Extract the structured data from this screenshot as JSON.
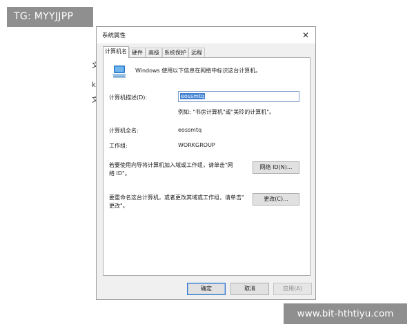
{
  "watermarks": {
    "top": "TG: MYYJJPP",
    "bottom": "www.bit-hthtiyu.com"
  },
  "background_fragments": [
    "文",
    "k",
    "文"
  ],
  "window": {
    "title": "系统属性",
    "close_glyph": "✕"
  },
  "tabs": [
    {
      "label": "计算机名",
      "active": true
    },
    {
      "label": "硬件",
      "active": false
    },
    {
      "label": "高级",
      "active": false
    },
    {
      "label": "系统保护",
      "active": false
    },
    {
      "label": "远程",
      "active": false
    }
  ],
  "computer_name_tab": {
    "intro_text": "Windows 使用以下信息在网络中标识这台计算机。",
    "description_label": "计算机描述(D):",
    "description_value": "eossmtq",
    "description_example": "例如: \"书房计算机\"或\"美玲的计算机\"。",
    "full_name_label": "计算机全名:",
    "full_name_value": "eossmtq",
    "workgroup_label": "工作组:",
    "workgroup_value": "WORKGROUP",
    "network_id_text_line1": "若要使用向导将计算机加入域或工作组，请单击\"网",
    "network_id_text_line2": "络 ID\"。",
    "network_id_button": "网络 ID(N)...",
    "rename_text_line1": "要重命名这台计算机，或者更改其域或工作组，请单击\"",
    "rename_text_line2": "更改\"。",
    "change_button": "更改(C)..."
  },
  "footer": {
    "ok_button": "确定",
    "cancel_button": "取消",
    "apply_button": "应用(A)"
  },
  "icons": {
    "computer": "computer-icon",
    "close": "close-icon"
  },
  "colors": {
    "window_bg": "#f0f0f0",
    "panel_bg": "#ffffff",
    "selection": "#3f7fd1",
    "input_border": "#7a9bc7",
    "watermark_bg": "#8f8f8f"
  }
}
